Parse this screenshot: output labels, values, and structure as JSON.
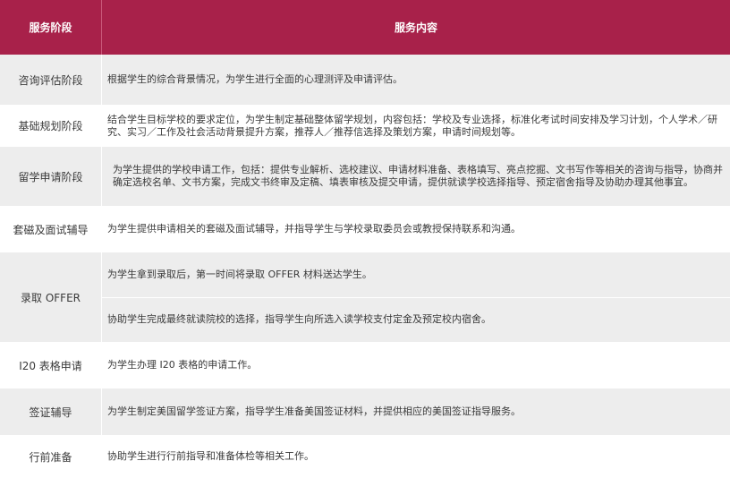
{
  "header": {
    "stage": "服务阶段",
    "content": "服务内容"
  },
  "rows": [
    {
      "stage": "咨询评估阶段",
      "content": "根据学生的综合背景情况，为学生进行全面的心理测评及申请评估。"
    },
    {
      "stage": "基础规划阶段",
      "content": "结合学生目标学校的要求定位，为学生制定基础整体留学规划，内容包括：学校及专业选择，标准化考试时间安排及学习计划，个人学术／研究、实习／工作及社会活动背景提升方案，推荐人／推荐信选择及策划方案，申请时间规划等。"
    },
    {
      "stage": "留学申请阶段",
      "content": "为学生提供的学校申请工作，包括：提供专业解析、选校建议、申请材料准备、表格填写、亮点挖掘、文书写作等相关的咨询与指导，协商并确定选校名单、文书方案，完成文书终审及定稿、填表审核及提交申请，提供就读学校选择指导、预定宿舍指导及协助办理其他事宜。"
    },
    {
      "stage": "套磁及面试辅导",
      "content": "为学生提供申请相关的套磁及面试辅导，并指导学生与学校录取委员会或教授保持联系和沟通。"
    },
    {
      "stage": "录取 OFFER",
      "content_1": "为学生拿到录取后，第一时间将录取 OFFER 材料送达学生。",
      "content_2": "协助学生完成最终就读院校的选择，指导学生向所选入读学校支付定金及预定校内宿舍。"
    },
    {
      "stage": "I20 表格申请",
      "content": "为学生办理 I20 表格的申请工作。"
    },
    {
      "stage": "签证辅导",
      "content": "为学生制定美国留学签证方案，指导学生准备美国签证材料，并提供相应的美国签证指导服务。"
    },
    {
      "stage": "行前准备",
      "content": "协助学生进行行前指导和准备体检等相关工作。"
    }
  ],
  "colors": {
    "header": "#a8214a",
    "row_alt": "#ededed"
  }
}
